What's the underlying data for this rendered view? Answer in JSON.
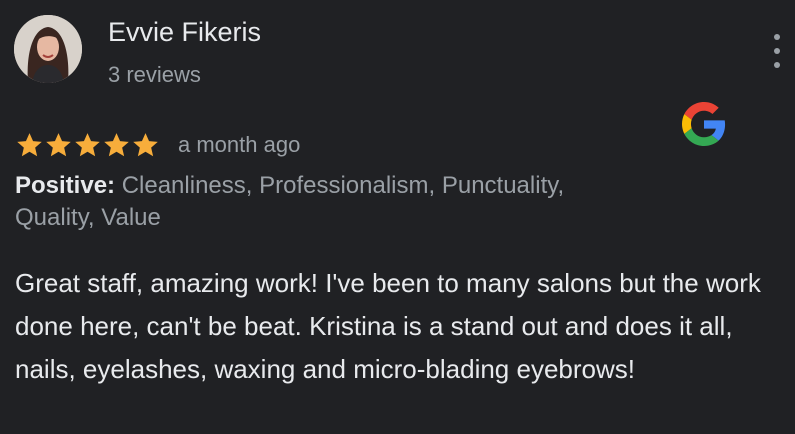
{
  "author": {
    "name": "Evvie Fikeris",
    "meta": "3 reviews"
  },
  "review": {
    "rating": 5,
    "rating_max": 5,
    "time": "a month ago",
    "highlights_label": "Positive:",
    "highlights_line1": " Cleanliness, Professionalism, Punctuality,",
    "highlights_line2": " Quality, Value",
    "text": "Great staff, amazing work! I've been to many salons but the work done here, can't be beat. Kristina is a stand out and does it all, nails, eyelashes, waxing and micro-blading eyebrows!"
  },
  "icons": {
    "menu": "more-vert-icon",
    "source": "google-logo-icon",
    "star": "star-icon"
  },
  "colors": {
    "background": "#202124",
    "star": "#f7ad3b",
    "text_primary": "#e8eaed",
    "text_secondary": "#9aa0a6"
  }
}
